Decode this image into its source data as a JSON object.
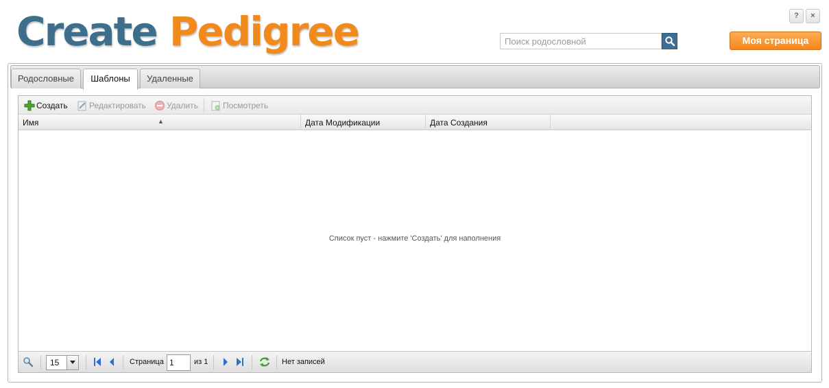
{
  "header": {
    "logo_part1": "Create",
    "logo_part2": "Pedigree",
    "help_label": "?",
    "close_label": "×",
    "search_placeholder": "Поиск родословной",
    "my_page_label": "Моя страница"
  },
  "tabs": [
    {
      "label": "Родословные",
      "active": false
    },
    {
      "label": "Шаблоны",
      "active": true
    },
    {
      "label": "Удаленные",
      "active": false
    }
  ],
  "toolbar": {
    "create_label": "Создать",
    "edit_label": "Редактировать",
    "delete_label": "Удалить",
    "view_label": "Посмотреть"
  },
  "columns": {
    "name": "Имя",
    "modified": "Дата Модификации",
    "created": "Дата Создания"
  },
  "empty_message": "Список пуст - нажмите 'Создать' для наполнения",
  "pager": {
    "page_size": "15",
    "page_label": "Страница",
    "page_value": "1",
    "of_label": "из 1",
    "status": "Нет записей"
  },
  "colors": {
    "logo_blue": "#3d6f8c",
    "logo_orange": "#f18a1c",
    "accent_button": "#f3861e",
    "search_button": "#3e6f93"
  }
}
